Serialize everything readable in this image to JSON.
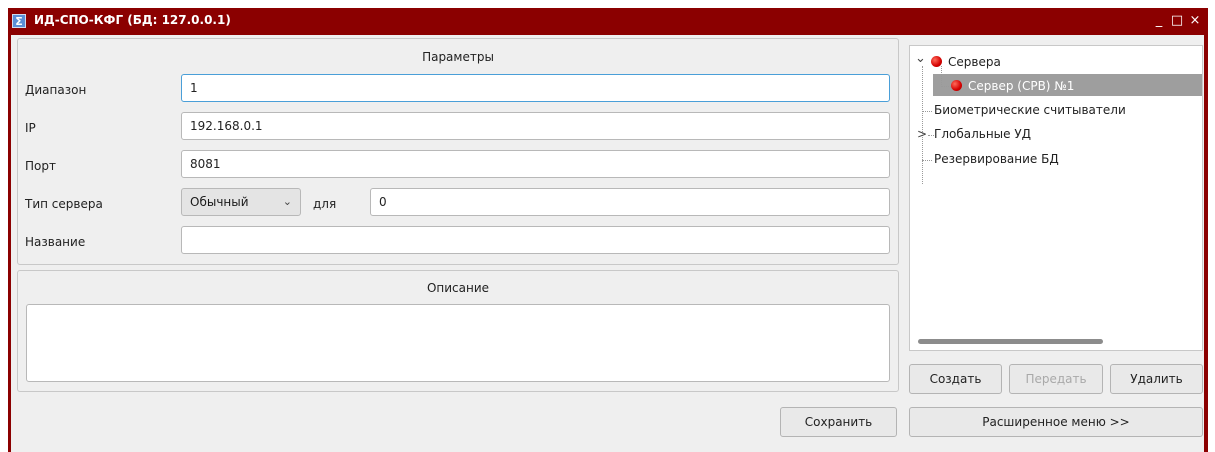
{
  "window": {
    "title": "ИД-СПО-КФГ (БД: 127.0.0.1)",
    "app_icon": "Σ",
    "controls": {
      "minimize": "_",
      "maximize": "□",
      "close": "×"
    }
  },
  "params": {
    "title": "Параметры",
    "range": {
      "label": "Диапазон",
      "value": "1"
    },
    "ip": {
      "label": "IP",
      "value": "192.168.0.1"
    },
    "port": {
      "label": "Порт",
      "value": "8081"
    },
    "server_type": {
      "label": "Тип сервера",
      "selected": "Обычный",
      "for_label": "для",
      "for_value": "0"
    },
    "name": {
      "label": "Название",
      "value": ""
    }
  },
  "description": {
    "title": "Описание",
    "value": ""
  },
  "tree": {
    "servers": "Сервера",
    "server_1": "Сервер (СРВ) №1",
    "biometric": "Биометрические считыватели",
    "global": "Глобальные УД",
    "backup": "Резервирование БД"
  },
  "buttons": {
    "create": "Создать",
    "transfer": "Передать",
    "delete": "Удалить",
    "save": "Сохранить",
    "extended_menu": "Расширенное меню >>"
  },
  "icons": {
    "expand_open": "⌄",
    "expand_closed": ">",
    "combo_arrow": "⌄"
  },
  "colors": {
    "titlebar": "#8b0000",
    "focus": "#4a9fd8",
    "selection": "#9e9e9e",
    "status_dot": "#d40000"
  }
}
